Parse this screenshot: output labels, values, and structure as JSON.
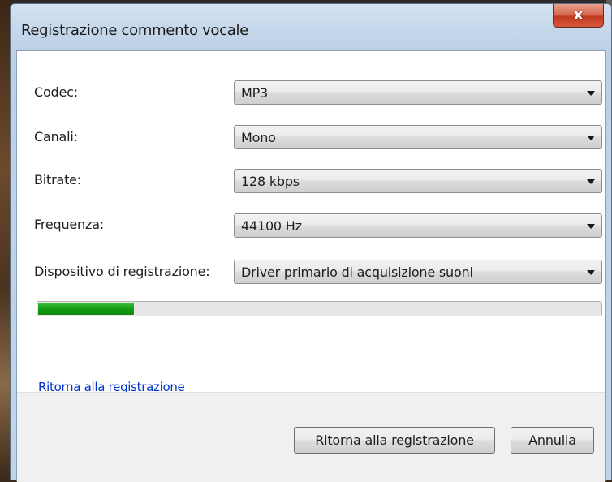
{
  "window": {
    "title": "Registrazione commento vocale",
    "close_label": "x"
  },
  "form": {
    "codec": {
      "label": "Codec:",
      "value": "MP3"
    },
    "channels": {
      "label": "Canali:",
      "value": "Mono"
    },
    "bitrate": {
      "label": "Bitrate:",
      "value": "128 kbps"
    },
    "frequency": {
      "label": "Frequenza:",
      "value": "44100 Hz"
    },
    "device": {
      "label": "Dispositivo di registrazione:",
      "value": "Driver primario di acquisizione suoni"
    }
  },
  "progress": {
    "fraction": 0.17,
    "color": "#159a15"
  },
  "link": {
    "label": "Ritorna alla registrazione"
  },
  "buttons": {
    "back_label": "Ritorna alla registrazione",
    "cancel_label": "Annulla"
  }
}
